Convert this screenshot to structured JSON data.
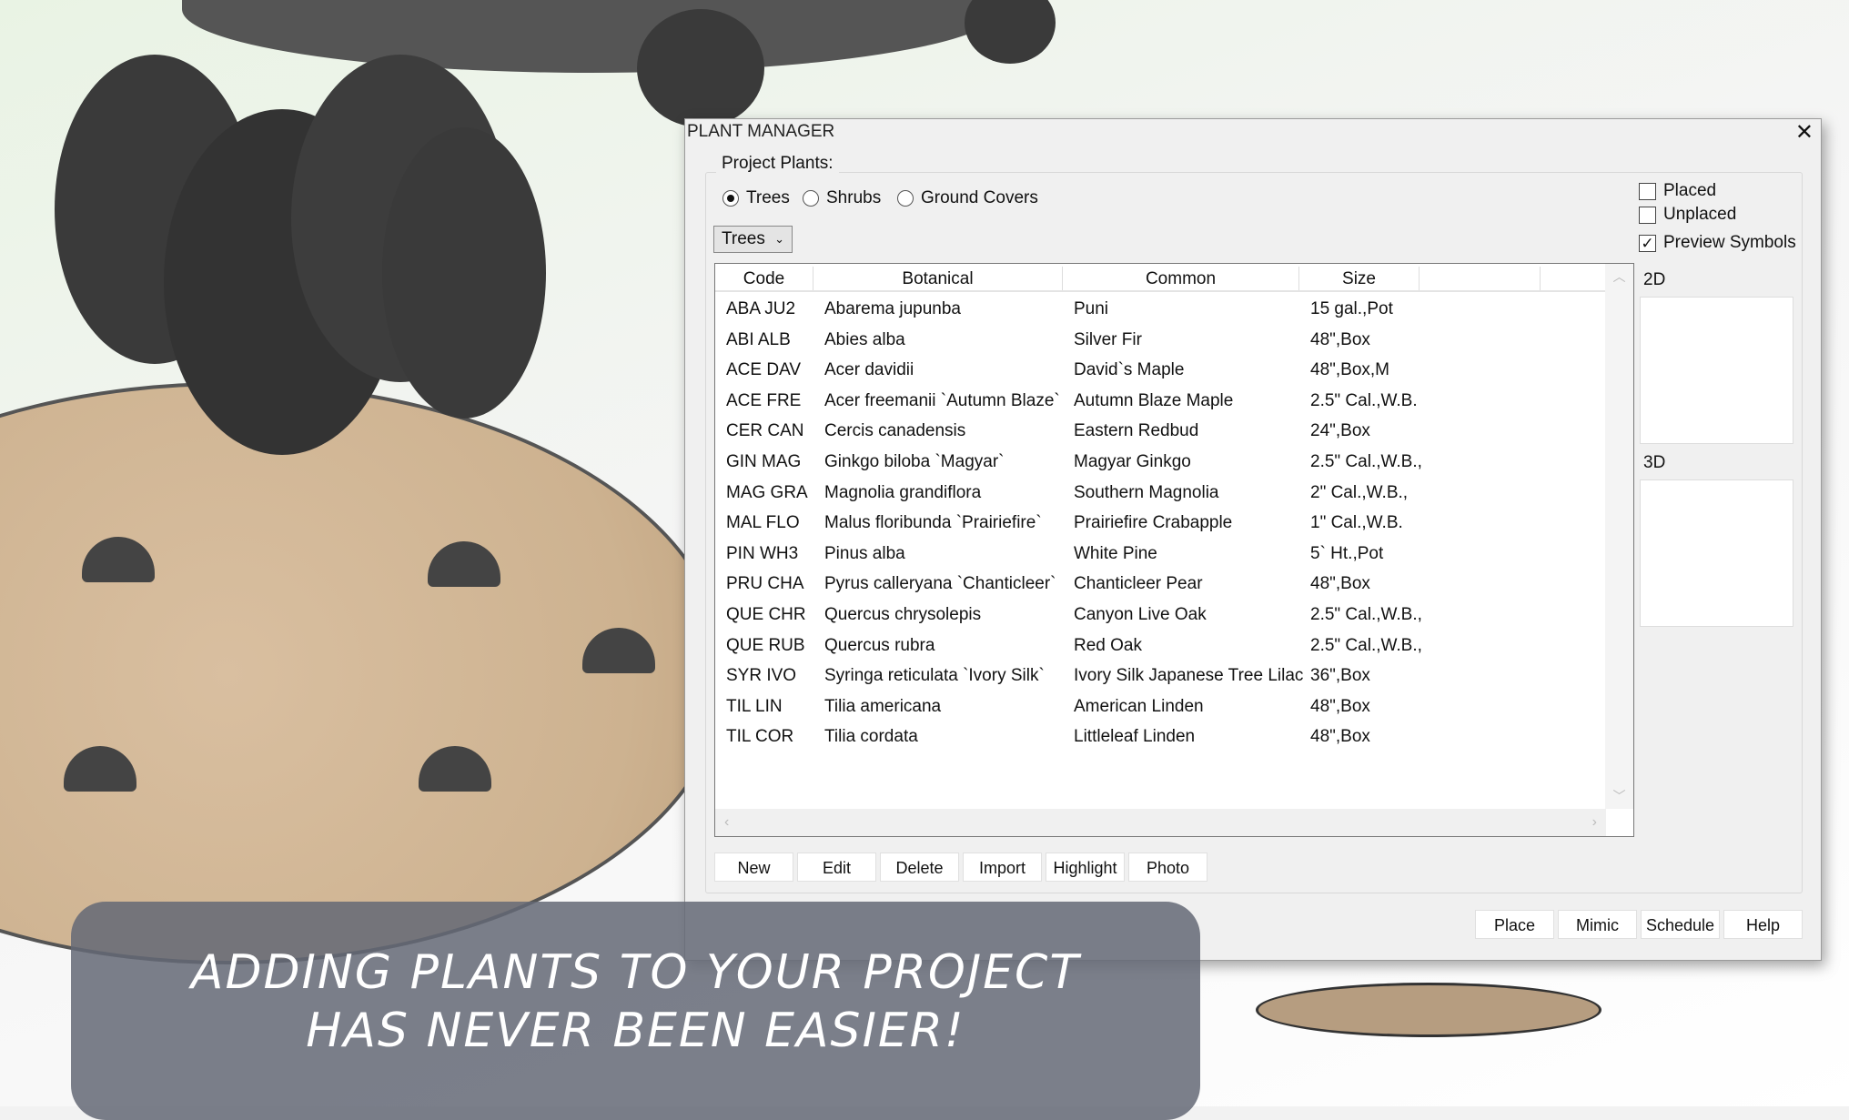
{
  "dialog": {
    "title": "PLANT MANAGER",
    "close_icon": "close-icon"
  },
  "project_plants": {
    "label": "Project Plants:",
    "radios": [
      {
        "label": "Trees",
        "selected": true
      },
      {
        "label": "Shrubs",
        "selected": false
      },
      {
        "label": "Ground Covers",
        "selected": false
      }
    ],
    "dropdown": {
      "value": "Trees"
    }
  },
  "filters": {
    "placed": {
      "label": "Placed",
      "checked": false
    },
    "unplaced": {
      "label": "Unplaced",
      "checked": false
    },
    "preview": {
      "label": "Preview Symbols",
      "checked": true
    }
  },
  "table": {
    "columns": [
      "Code",
      "Botanical",
      "Common",
      "Size"
    ],
    "rows": [
      [
        "ABA JU2",
        "Abarema jupunba",
        "Puni",
        "15 gal.,Pot"
      ],
      [
        "ABI ALB",
        "Abies alba",
        "Silver Fir",
        "48\",Box"
      ],
      [
        "ACE DAV",
        "Acer davidii",
        "David`s Maple",
        "48\",Box,M"
      ],
      [
        "ACE FRE",
        "Acer freemanii `Autumn Blaze`",
        "Autumn Blaze Maple",
        "2.5\" Cal.,W.B."
      ],
      [
        "CER CAN",
        "Cercis canadensis",
        "Eastern Redbud",
        "24\",Box"
      ],
      [
        "GIN MAG",
        "Ginkgo biloba `Magyar`",
        "Magyar Ginkgo",
        "2.5\" Cal.,W.B.,"
      ],
      [
        "MAG GRA",
        "Magnolia grandiflora",
        "Southern Magnolia",
        "2\" Cal.,W.B.,"
      ],
      [
        "MAL FLO",
        "Malus floribunda `Prairiefire`",
        "Prairiefire Crabapple",
        "1\" Cal.,W.B."
      ],
      [
        "PIN WH3",
        "Pinus alba",
        "White Pine",
        "5` Ht.,Pot"
      ],
      [
        "PRU CHA",
        "Pyrus calleryana `Chanticleer`",
        "Chanticleer Pear",
        "48\",Box"
      ],
      [
        "QUE CHR",
        "Quercus chrysolepis",
        "Canyon Live Oak",
        "2.5\" Cal.,W.B.,"
      ],
      [
        "QUE RUB",
        "Quercus rubra",
        "Red Oak",
        "2.5\" Cal.,W.B.,"
      ],
      [
        "SYR IVO",
        "Syringa reticulata `Ivory Silk`",
        "Ivory Silk Japanese Tree Lilac",
        "36\",Box"
      ],
      [
        "TIL LIN",
        "Tilia americana",
        "American Linden",
        "48\",Box"
      ],
      [
        "TIL COR",
        "Tilia cordata",
        "Littleleaf Linden",
        "48\",Box"
      ]
    ]
  },
  "preview": {
    "label_2d": "2D",
    "label_3d": "3D"
  },
  "actions": [
    "New",
    "Edit",
    "Delete",
    "Import",
    "Highlight",
    "Photo"
  ],
  "footer_buttons": [
    "Place",
    "Mimic",
    "Schedule",
    "Help"
  ],
  "caption": {
    "line1": "Adding plants to your project",
    "line2": "has never been easier!"
  }
}
